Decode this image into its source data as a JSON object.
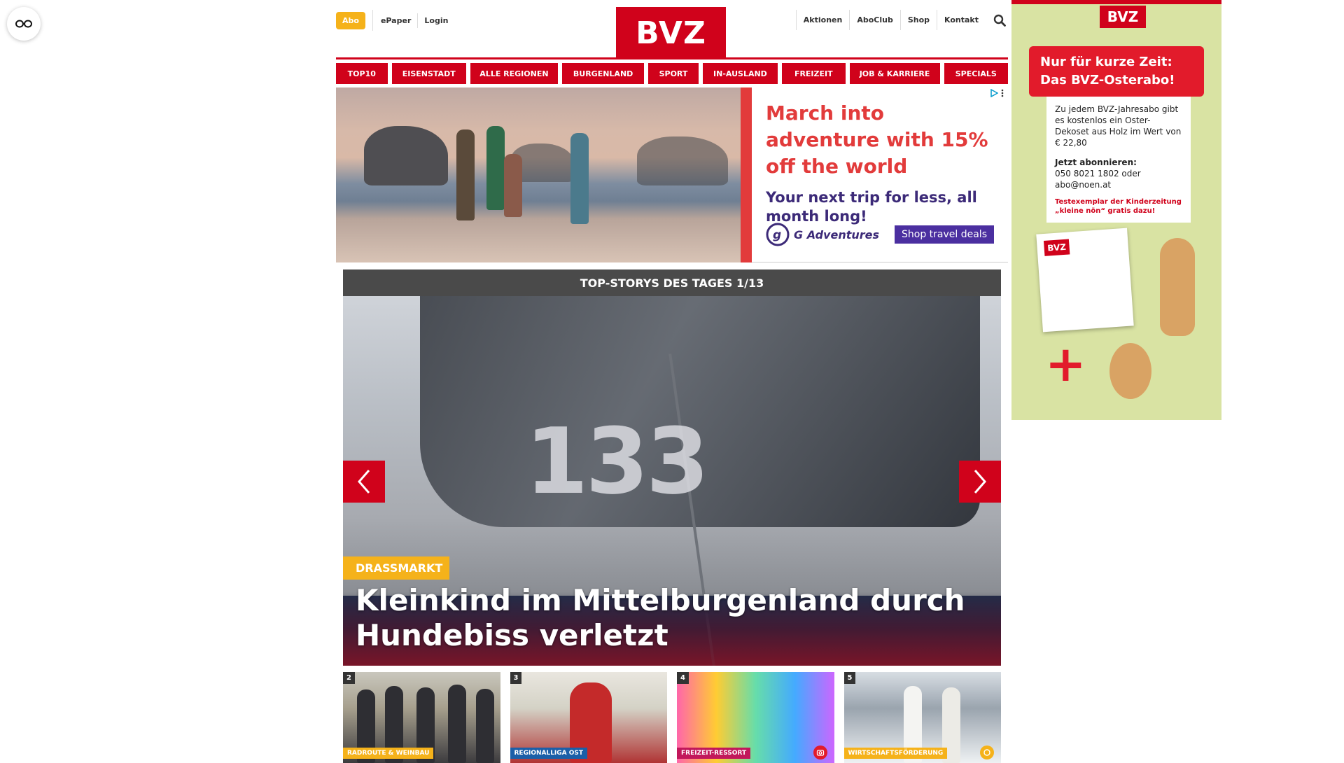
{
  "header": {
    "abo": "Abo",
    "left_links": [
      "ePaper",
      "Login"
    ],
    "logo": "BVZ",
    "right_links": [
      "Aktionen",
      "AboClub",
      "Shop",
      "Kontakt"
    ]
  },
  "nav": [
    "TOP10",
    "EISENSTADT",
    "ALLE REGIONEN",
    "BURGENLAND",
    "SPORT",
    "IN-AUSLAND",
    "FREIZEIT",
    "JOB & KARRIERE",
    "SPECIALS"
  ],
  "ad": {
    "title": "March into adventure with 15% off the world",
    "subtitle": "Your next trip for less, all month long!",
    "brand": "G Adventures",
    "cta": "Shop travel deals"
  },
  "top_stories": {
    "heading": "TOP-STORYS DES TAGES 1/13",
    "hero": {
      "plate": "133",
      "tag": "DRASSMARKT",
      "title": "Kleinkind im Mittelburgenland durch Hundebiss verletzt"
    },
    "thumbs": [
      {
        "num": "2",
        "cat": "RADROUTE & WEINBAU"
      },
      {
        "num": "3",
        "cat": "REGIONALLIGA OST"
      },
      {
        "num": "4",
        "cat": "FREIZEIT-RESSORT"
      },
      {
        "num": "5",
        "cat": "WIRTSCHAFTSFÖRDERUNG"
      }
    ]
  },
  "side_ad": {
    "logo": "BVZ",
    "headline": "Nur für kurze Zeit: Das BVZ-Osterabo!",
    "body": "Zu jedem BVZ-Jahresabo gibt es kostenlos ein Oster-Dekoset aus Holz im Wert von € 22,80",
    "cta_title": "Jetzt abonnieren:",
    "contact": "050 8021 1802 oder abo@noen.at",
    "promo": "Testexemplar der Kinderzeitung „kleine nön“ gratis dazu!",
    "mag_logo": "BVZ",
    "plus": "+"
  }
}
